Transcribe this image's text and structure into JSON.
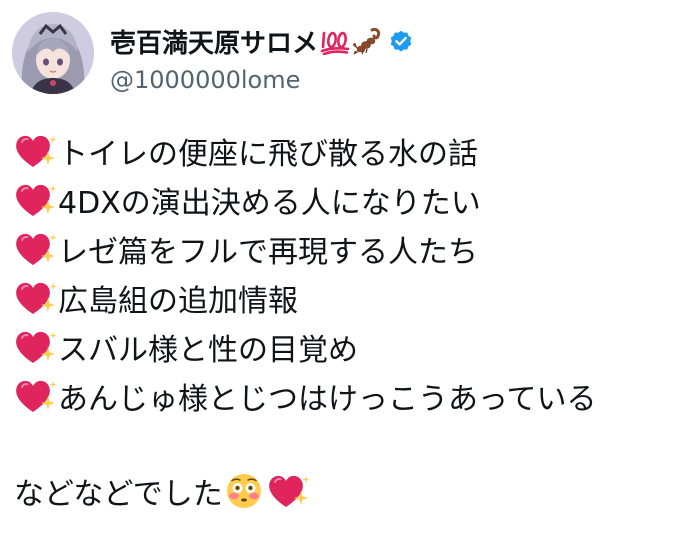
{
  "author": {
    "display_name": "壱百満天原サロメ",
    "handle": "@1000000lome",
    "avatar": "avatar-image",
    "name_icons": [
      "hundred-points-icon",
      "scorpion-icon",
      "verified-badge-icon"
    ],
    "verified_color": "#1d9bf0"
  },
  "tweet": {
    "bullet_icon": "sparkling-heart-icon",
    "items": [
      "トイレの便座に飛び散る水の話",
      "4DXの演出決める人になりたい",
      "レゼ篇をフルで再現する人たち",
      "広島組の追加情報",
      "スバル様と性の目覚め",
      "あんじゅ様とじつはけっこうあっている"
    ],
    "outro": "などなどでした",
    "outro_icons": [
      "flushed-face-icon",
      "sparkling-heart-icon"
    ]
  },
  "colors": {
    "text": "#0f1419",
    "secondary_text": "#536471",
    "heart": "#e0245e",
    "sparkle": "#ffcc4d"
  }
}
